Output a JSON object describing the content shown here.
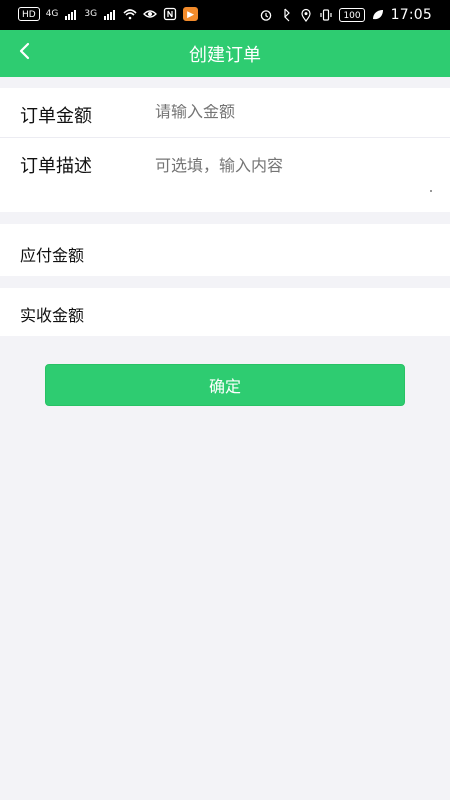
{
  "status_bar": {
    "left_badges": [
      "HD",
      "4G",
      "3G"
    ],
    "time": "17:05",
    "battery": "100"
  },
  "header": {
    "title": "创建订单",
    "back_icon": "chevron-left-icon"
  },
  "form": {
    "amount_label": "订单金额",
    "amount_placeholder": "请输入金额",
    "desc_label": "订单描述",
    "desc_placeholder": "可选填，输入内容"
  },
  "summary": {
    "payable_label": "应付金额",
    "received_label": "实收金额"
  },
  "actions": {
    "confirm_label": "确定"
  },
  "colors": {
    "primary": "#2ECC71",
    "background": "#F3F3F7"
  }
}
